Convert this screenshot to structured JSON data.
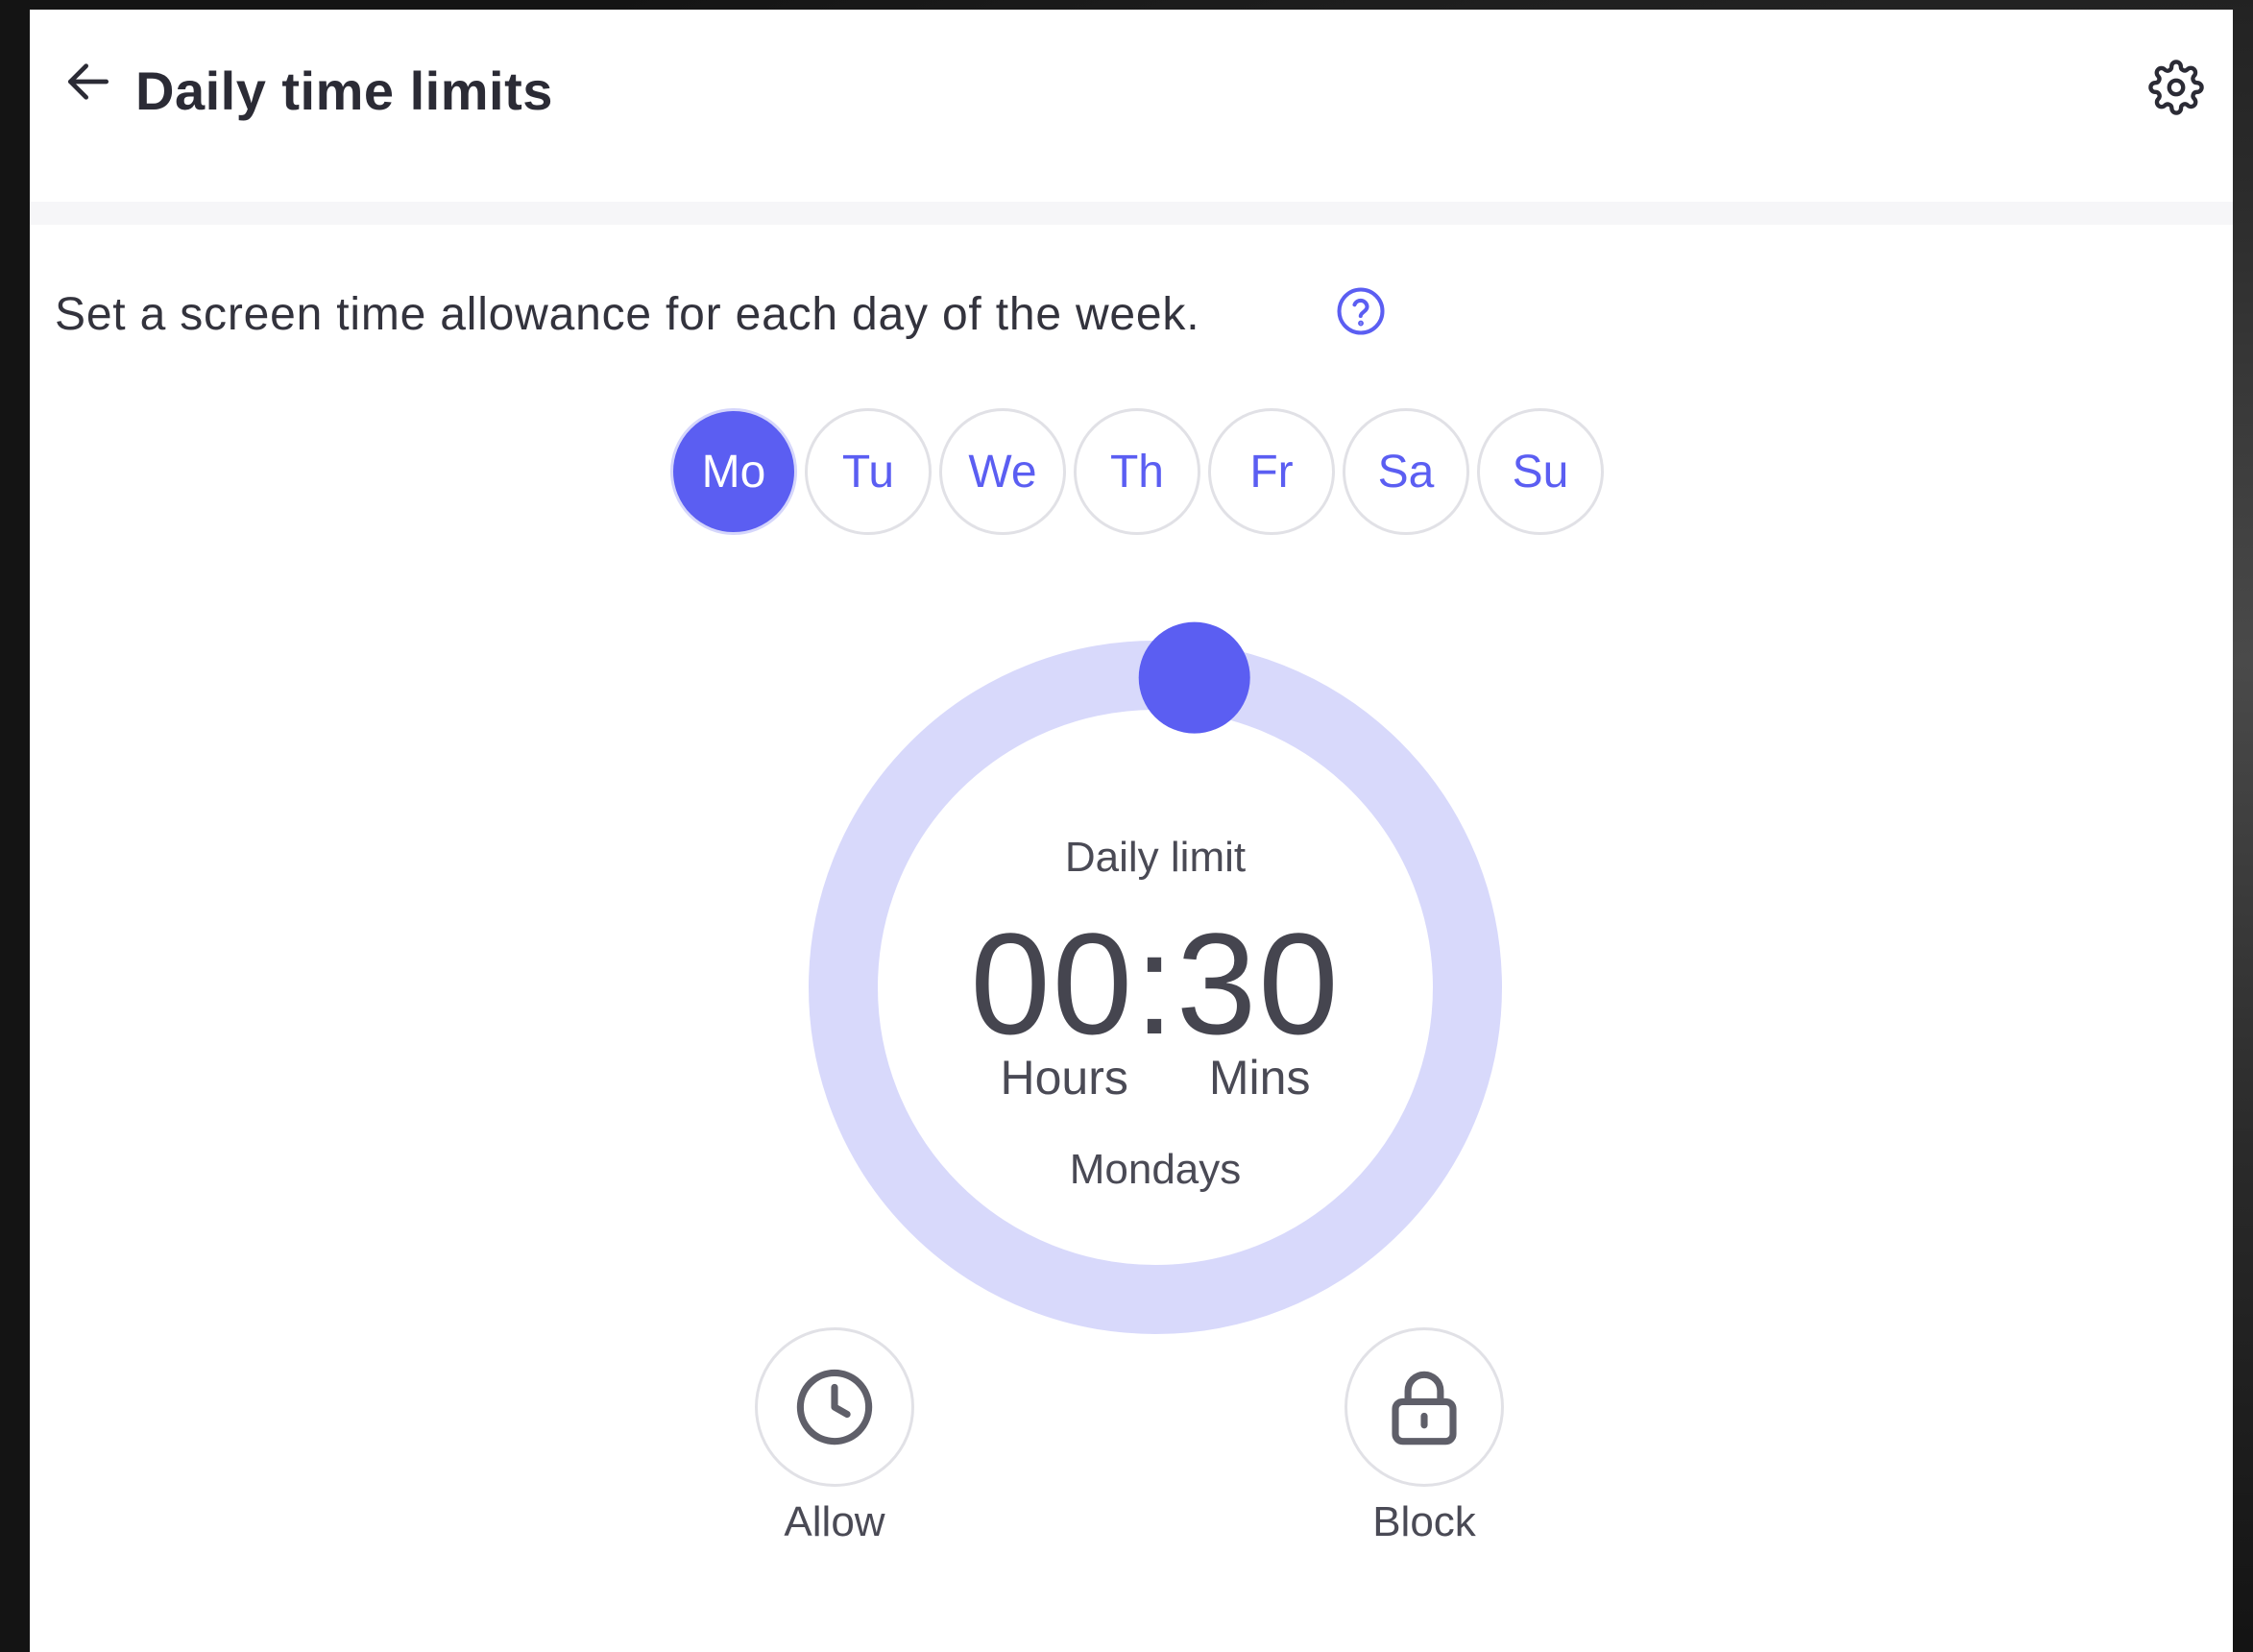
{
  "header": {
    "title": "Daily time limits",
    "back_icon": "arrow-left-icon",
    "settings_icon": "gear-icon"
  },
  "intro": {
    "text": "Set a screen time allowance for each day of the week.",
    "help_icon": "question-circle-icon"
  },
  "days": [
    {
      "label": "Mo",
      "selected": true
    },
    {
      "label": "Tu",
      "selected": false
    },
    {
      "label": "We",
      "selected": false
    },
    {
      "label": "Th",
      "selected": false
    },
    {
      "label": "Fr",
      "selected": false
    },
    {
      "label": "Sa",
      "selected": false
    },
    {
      "label": "Su",
      "selected": false
    }
  ],
  "dial": {
    "label": "Daily limit",
    "value": "00:30",
    "hours_label": "Hours",
    "mins_label": "Mins",
    "day_name": "Mondays",
    "progress_fraction": 0.02
  },
  "actions": {
    "allow_label": "Allow",
    "allow_icon": "clock-icon",
    "block_label": "Block",
    "block_icon": "lock-icon"
  },
  "colors": {
    "accent": "#5b5ef2",
    "dial_track": "#d8d9fb",
    "text_dark": "#2b2b35",
    "text_muted": "#4a4a55"
  }
}
